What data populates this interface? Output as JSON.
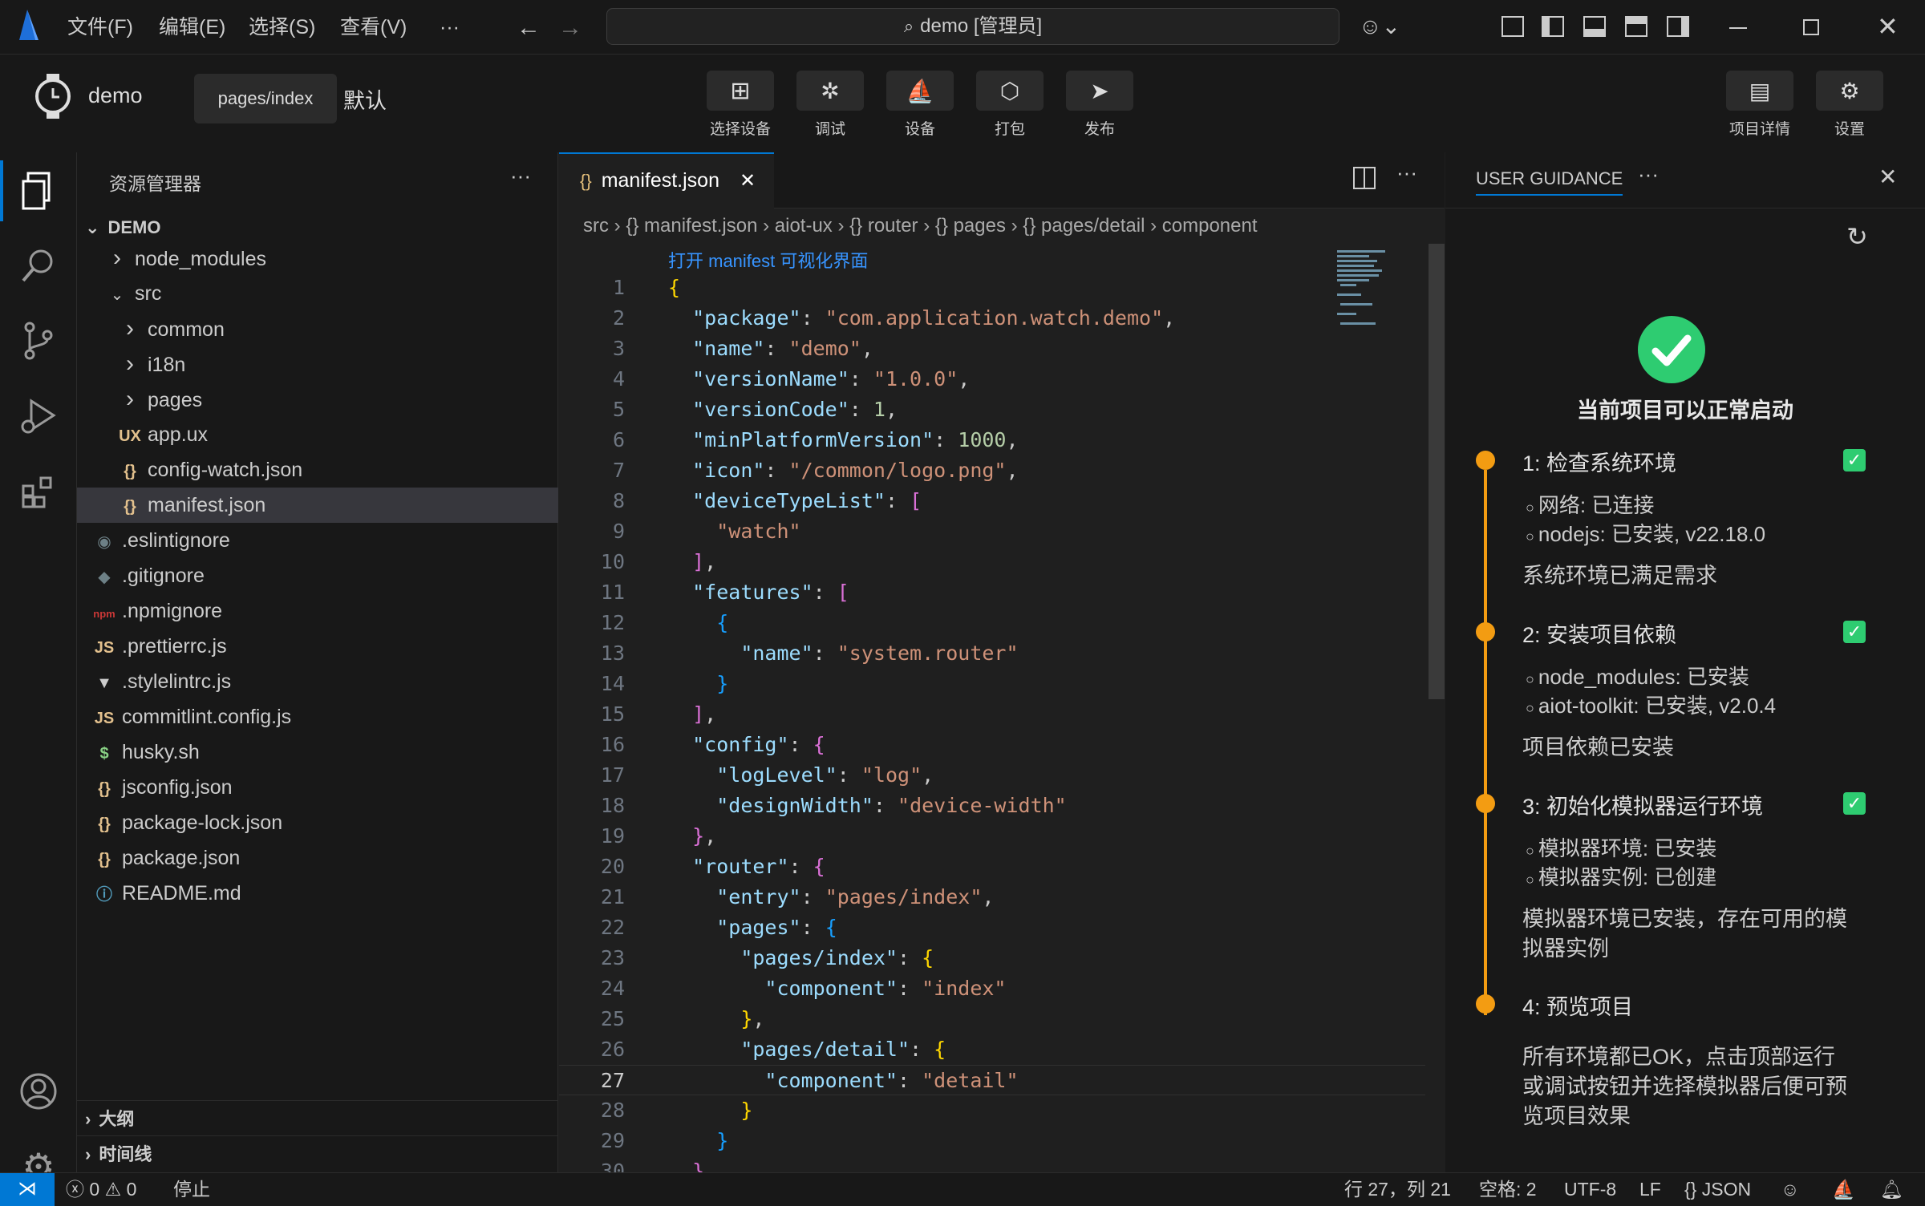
{
  "titlebar": {
    "menus": [
      "文件(F)",
      "编辑(E)",
      "选择(S)",
      "查看(V)",
      "···"
    ],
    "command_center": "demo [管理员]"
  },
  "appbar": {
    "project_name": "demo",
    "page_selector": "pages/index",
    "mode": "默认",
    "tools": [
      "选择设备",
      "调试",
      "设备",
      "打包",
      "发布"
    ],
    "right_tools": [
      "项目详情",
      "设置"
    ]
  },
  "explorer": {
    "title": "资源管理器",
    "more": "···",
    "root": "DEMO",
    "items": [
      {
        "label": "node_modules",
        "icon": "chevron-right"
      },
      {
        "label": "src",
        "icon": "chevron-down"
      },
      {
        "label": "common",
        "icon": "chevron-right"
      },
      {
        "label": "i18n",
        "icon": "chevron-right"
      },
      {
        "label": "pages",
        "icon": "chevron-right"
      },
      {
        "label": "app.ux",
        "icon": "UX"
      },
      {
        "label": "config-watch.json",
        "icon": "{}"
      },
      {
        "label": "manifest.json",
        "icon": "{}"
      },
      {
        "label": ".eslintignore",
        "icon": "◉"
      },
      {
        "label": ".gitignore",
        "icon": "◆"
      },
      {
        "label": ".npmignore",
        "icon": "npm"
      },
      {
        "label": ".prettierrc.js",
        "icon": "JS"
      },
      {
        "label": ".stylelintrc.js",
        "icon": "▼"
      },
      {
        "label": "commitlint.config.js",
        "icon": "JS"
      },
      {
        "label": "husky.sh",
        "icon": "$"
      },
      {
        "label": "jsconfig.json",
        "icon": "{}"
      },
      {
        "label": "package-lock.json",
        "icon": "{}"
      },
      {
        "label": "package.json",
        "icon": "{}"
      },
      {
        "label": "README.md",
        "icon": "ⓘ"
      }
    ],
    "outline": "大纲",
    "timeline": "时间线"
  },
  "editor": {
    "tab": "manifest.json",
    "tab_icon": "{}",
    "breadcrumbs": [
      "src",
      "{} manifest.json",
      "aiot-ux",
      "{} router",
      "{} pages",
      "{} pages/detail",
      "component"
    ],
    "codelens": "打开 manifest 可视化界面",
    "lines": [
      "{",
      "  \"package\": \"com.application.watch.demo\",",
      "  \"name\": \"demo\",",
      "  \"versionName\": \"1.0.0\",",
      "  \"versionCode\": 1,",
      "  \"minPlatformVersion\": 1000,",
      "  \"icon\": \"/common/logo.png\",",
      "  \"deviceTypeList\": [",
      "    \"watch\"",
      "  ],",
      "  \"features\": [",
      "    {",
      "      \"name\": \"system.router\"",
      "    }",
      "  ],",
      "  \"config\": {",
      "    \"logLevel\": \"log\",",
      "    \"designWidth\": \"device-width\"",
      "  },",
      "  \"router\": {",
      "    \"entry\": \"pages/index\",",
      "    \"pages\": {",
      "      \"pages/index\": {",
      "        \"component\": \"index\"",
      "      },",
      "      \"pages/detail\": {",
      "        \"component\": \"detail\"",
      "      }",
      "    }",
      "  }"
    ]
  },
  "guidance": {
    "title": "USER GUIDANCE",
    "more": "···",
    "status": "当前项目可以正常启动",
    "steps": [
      {
        "title": "1: 检查系统环境",
        "items": [
          "网络: 已连接",
          "nodejs: 已安装, v22.18.0"
        ],
        "summary": [
          "系统环境已满足需求"
        ],
        "checked": true
      },
      {
        "title": "2: 安装项目依赖",
        "items": [
          "node_modules: 已安装",
          "aiot-toolkit: 已安装, v2.0.4"
        ],
        "summary": [
          "项目依赖已安装"
        ],
        "checked": true
      },
      {
        "title": "3: 初始化模拟器运行环境",
        "items": [
          "模拟器环境: 已安装",
          "模拟器实例: 已创建"
        ],
        "summary": [
          "模拟器环境已安装，存在可用的模",
          "拟器实例"
        ],
        "checked": true
      },
      {
        "title": "4: 预览项目",
        "items": [],
        "summary": [
          "所有环境都已OK，点击顶部运行",
          "或调试按钮并选择模拟器后便可预",
          "览项目效果"
        ],
        "checked": false
      }
    ]
  },
  "statusbar": {
    "errors": "0",
    "warnings": "0",
    "stop": "停止",
    "position": "行 27，列 21",
    "spaces": "空格: 2",
    "encoding": "UTF-8",
    "eol": "LF",
    "language": "JSON"
  },
  "colors": {
    "accent": "#0078d4",
    "success": "#2ecc71",
    "step": "#f39c12"
  }
}
